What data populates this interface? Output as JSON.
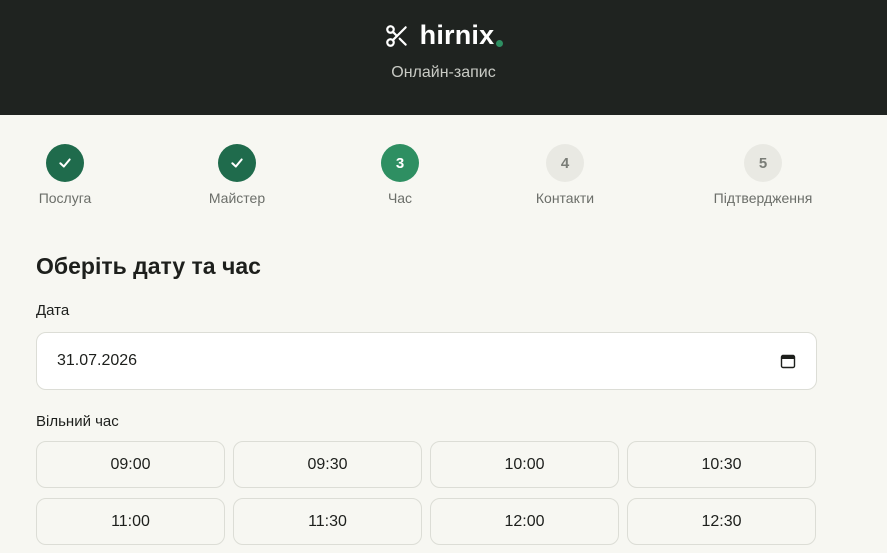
{
  "header": {
    "brand_name": "hirnix",
    "subtitle": "Онлайн-запис",
    "brand_icon": "scissors-icon",
    "accent_color": "#2e8f62"
  },
  "steps": [
    {
      "label": "Послуга",
      "number": "1",
      "state": "done",
      "icon": "check-icon"
    },
    {
      "label": "Майстер",
      "number": "2",
      "state": "done",
      "icon": "check-icon"
    },
    {
      "label": "Час",
      "number": "3",
      "state": "current"
    },
    {
      "label": "Контакти",
      "number": "4",
      "state": "todo"
    },
    {
      "label": "Підтвердження",
      "number": "5",
      "state": "todo"
    }
  ],
  "main": {
    "title": "Оберіть дату та час",
    "date_label": "Дата",
    "date_value": "31.07.2026",
    "date_icon": "calendar-icon",
    "slots_label": "Вільний час",
    "slots": [
      "09:00",
      "09:30",
      "10:00",
      "10:30",
      "11:00",
      "11:30",
      "12:00",
      "12:30"
    ]
  }
}
